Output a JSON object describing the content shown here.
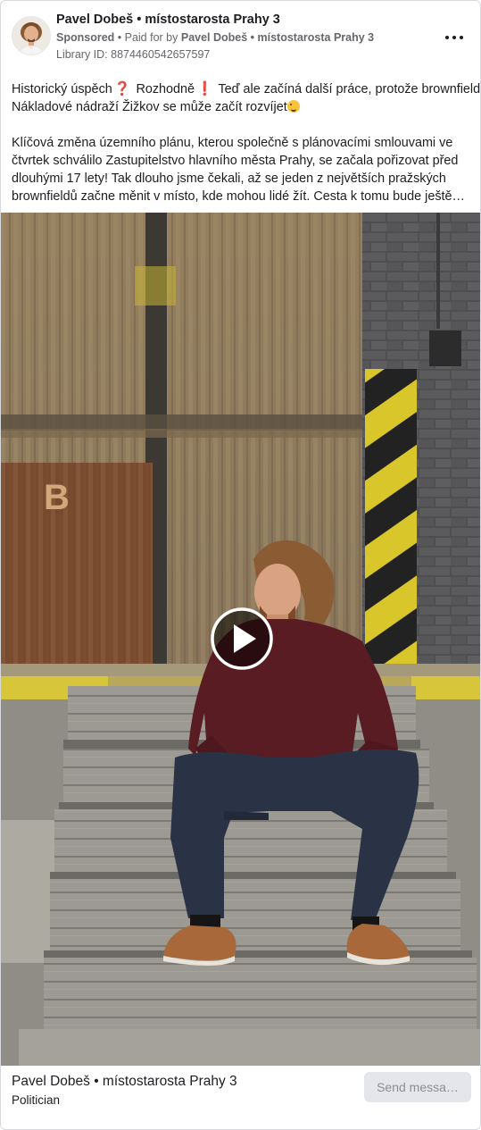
{
  "post": {
    "page_name": "Pavel Dobeš • místostarosta Prahy 3",
    "sponsored_label": "Sponsored",
    "paid_for_prefix": " • Paid for by ",
    "paid_for_by": "Pavel Dobeš • místostarosta Prahy 3",
    "library_id": "Library ID: 887446054265759​7",
    "more_icon": "more-horizontal-icon"
  },
  "body": {
    "line1_a": "Historický úspěch",
    "line1_b": " Rozhodně",
    "line1_c": " Teď ale začíná další práce, protože brownfield",
    "line2": "Nákladové nádraží Žižkov se může začít rozvíjet",
    "line3": "Klíčová změna územního plánu, kterou společně s plánovacími smlouvami ve",
    "line4": "čtvrtek schválilo Zastupitelstvo hlavního města Prahy, se začala pořizovat před",
    "line5": "dlouhými 17 lety! Tak dlouho jsme čekali, až se jeden z největších pražských",
    "line6": "brownfieldů začne měnit v místo, kde mohou lidé žít. Cesta k tomu bude ještě…",
    "emoji_question": "❓",
    "emoji_exclamation": "❗"
  },
  "media": {
    "wall_letter": "B",
    "play_icon": "play-icon"
  },
  "footer": {
    "name": "Pavel Dobeš • místostarosta Prahy 3",
    "category": "Politician",
    "cta_label": "Send messa…"
  },
  "colors": {
    "text": "#1c1e21",
    "secondary": "#65676b",
    "button_bg": "#e4e6eb",
    "button_text": "#8a8d91"
  }
}
